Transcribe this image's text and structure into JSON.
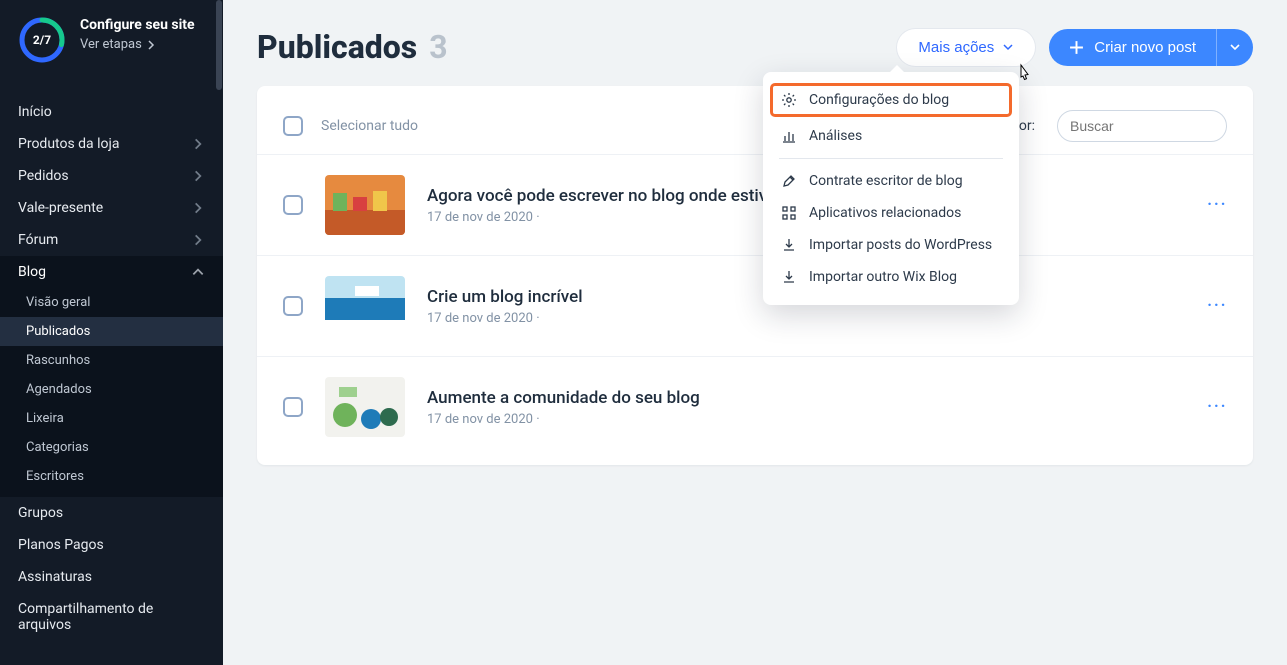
{
  "onboarding": {
    "progress_label": "2/7",
    "title": "Configure seu site",
    "link": "Ver etapas"
  },
  "sidebar": {
    "items": [
      {
        "label": "Início",
        "hasChildren": false
      },
      {
        "label": "Produtos da loja",
        "hasChildren": true
      },
      {
        "label": "Pedidos",
        "hasChildren": true
      },
      {
        "label": "Vale-presente",
        "hasChildren": true
      },
      {
        "label": "Fórum",
        "hasChildren": true
      },
      {
        "label": "Blog",
        "hasChildren": true,
        "expanded": true
      },
      {
        "label": "Grupos",
        "hasChildren": false
      },
      {
        "label": "Planos Pagos",
        "hasChildren": false
      },
      {
        "label": "Assinaturas",
        "hasChildren": false
      },
      {
        "label": "Compartilhamento de arquivos",
        "hasChildren": false
      }
    ],
    "blog_sub": [
      "Visão geral",
      "Publicados",
      "Rascunhos",
      "Agendados",
      "Lixeira",
      "Categorias",
      "Escritores"
    ],
    "blog_active_index": 1
  },
  "page": {
    "title": "Publicados",
    "count": "3",
    "more_actions": "Mais ações",
    "create_post": "Criar novo post"
  },
  "popup": {
    "items": [
      "Configurações do blog",
      "Análises",
      "Contrate escritor de blog",
      "Aplicativos relacionados",
      "Importar posts do WordPress",
      "Importar outro Wix Blog"
    ]
  },
  "toolbar": {
    "select_all": "Selecionar tudo",
    "filter": "Filtrar por:",
    "search_placeholder": "Buscar"
  },
  "posts": [
    {
      "title": "Agora você pode escrever no blog onde estiver!",
      "date": "17 de nov de 2020"
    },
    {
      "title": "Crie um blog incrível",
      "date": "17 de nov de 2020"
    },
    {
      "title": "Aumente a comunidade do seu blog",
      "date": "17 de nov de 2020"
    }
  ],
  "colors": {
    "accent": "#3c87ff",
    "ring_done": "#16c98d",
    "ring_track": "#2f68ff"
  }
}
